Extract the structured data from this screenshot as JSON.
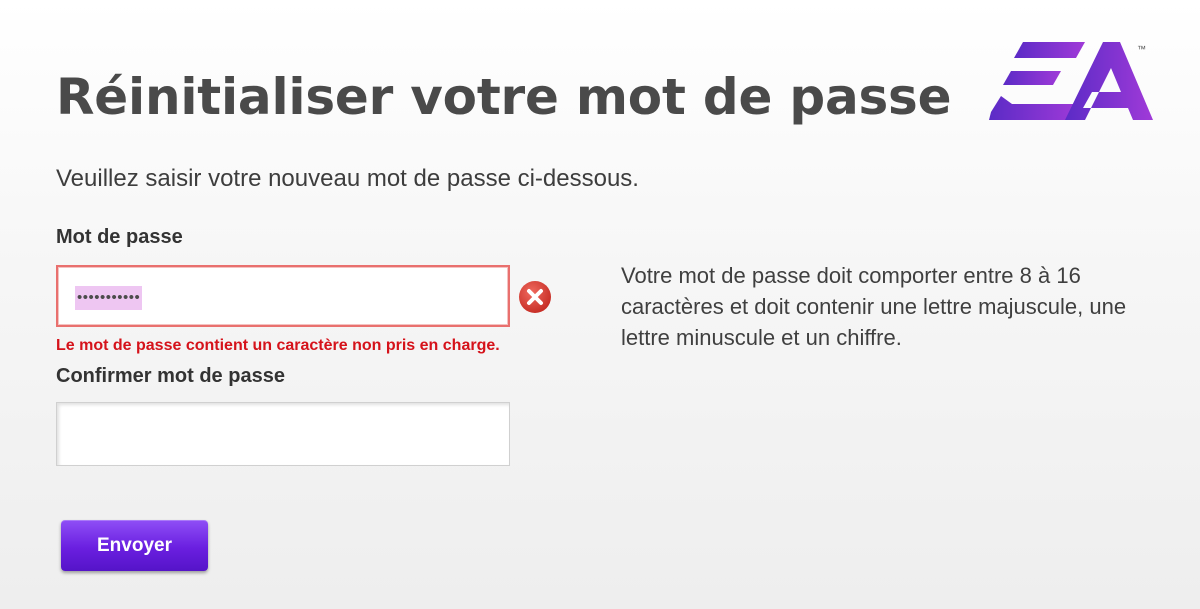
{
  "page": {
    "title": "Réinitialiser votre mot de passe",
    "subtitle": "Veuillez saisir votre nouveau mot de passe ci-dessous."
  },
  "brand": {
    "logo_text": "EA",
    "trademark": "™",
    "colors": {
      "logo_gradient_start": "#5b2bc6",
      "logo_gradient_end": "#a03ad8",
      "button": "#6a1fe0"
    }
  },
  "form": {
    "password_label": "Mot de passe",
    "password_value": "•••••••••••",
    "password_error_icon": "error-x-icon",
    "password_error": "Le mot de passe contient un caractère non pris en charge.",
    "confirm_label": "Confirmer mot de passe",
    "confirm_value": "",
    "submit_label": "Envoyer"
  },
  "hint": "Votre mot de passe doit comporter entre 8 à 16 caractères et doit contenir une lettre majuscule, une lettre minuscule et un chiffre.",
  "colors": {
    "error": "#d5121a",
    "error_border": "#e9706e"
  }
}
